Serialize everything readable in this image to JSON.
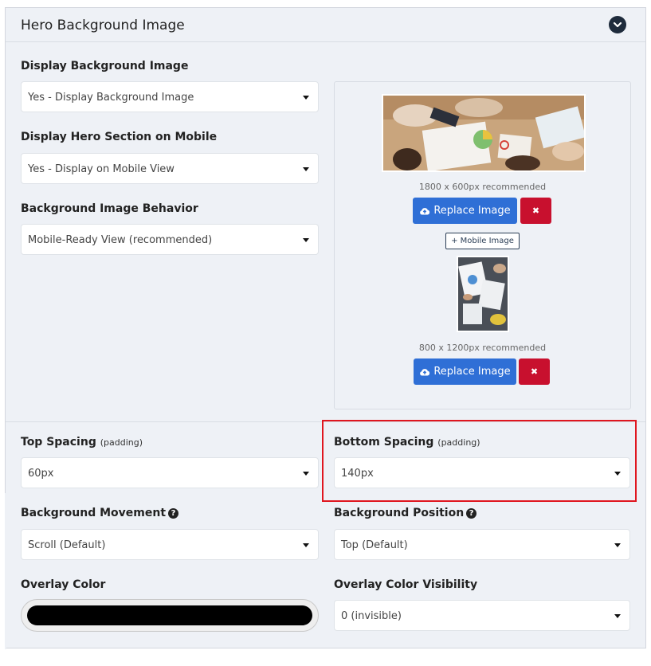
{
  "section": {
    "title": "Hero Background Image"
  },
  "fields": {
    "display_background_image": {
      "label": "Display Background Image",
      "value": "Yes - Display Background Image"
    },
    "display_hero_mobile": {
      "label": "Display Hero Section on Mobile",
      "value": "Yes - Display on Mobile View"
    },
    "background_image_behavior": {
      "label": "Background Image Behavior",
      "value": "Mobile-Ready View (recommended)"
    },
    "top_spacing": {
      "label": "Top Spacing",
      "sub": "(padding)",
      "value": "60px"
    },
    "bottom_spacing": {
      "label": "Bottom Spacing",
      "sub": "(padding)",
      "value": "140px"
    },
    "background_movement": {
      "label": "Background Movement",
      "value": "Scroll (Default)"
    },
    "background_position": {
      "label": "Background Position",
      "value": "Top (Default)"
    },
    "overlay_color": {
      "label": "Overlay Color",
      "color": "#000000"
    },
    "overlay_visibility": {
      "label": "Overlay Color Visibility",
      "value": "0 (invisible)"
    }
  },
  "images": {
    "desktop_hint": "1800 x 600px recommended",
    "desktop_replace_label": "Replace Image",
    "mobile_add_label": "+ Mobile Image",
    "mobile_hint": "800 x 1200px recommended",
    "mobile_replace_label": "Replace Image",
    "remove_symbol": "✖"
  },
  "icons": {
    "collapse": "chevron-down-icon",
    "upload": "cloud-upload-icon",
    "help": "question-circle-icon",
    "remove": "close-icon"
  },
  "colors": {
    "primary_button": "#2f6fd6",
    "danger_button": "#c8102e",
    "highlight_border": "#e0161f",
    "panel_background": "#eef1f6"
  }
}
